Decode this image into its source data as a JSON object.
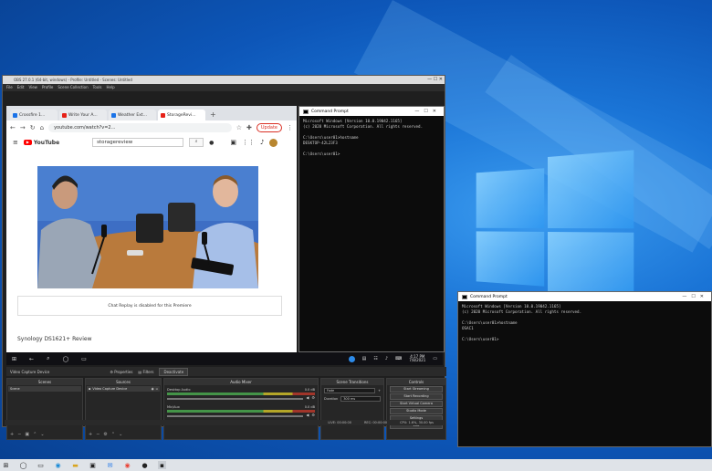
{
  "obs": {
    "title": "OBS 27.0.1 (64-bit, windows) - Profile: Untitled - Scenes: Untitled",
    "menu": [
      "File",
      "Edit",
      "View",
      "Profile",
      "Scene Collection",
      "Tools",
      "Help"
    ]
  },
  "chrome": {
    "tabs": [
      "Crossfire 1...",
      "Write Your A...",
      "Weather Ext...",
      "StorageRevi..."
    ],
    "address": "youtube.com/watch?v=2...",
    "update_label": "Update",
    "search_value": "storagereview",
    "logo_text": "YouTube",
    "chat_text": "Chat Replay is disabled for this Premiere",
    "below_text": "Synology DS1621+ Review"
  },
  "cmd_inner": {
    "title": "Command Prompt",
    "lines": [
      "Microsoft Windows [Version 10.0.19042.1165]",
      "(c) 2020 Microsoft Corporation. All rights reserved.",
      "",
      "C:\\Users\\user01>hostname",
      "DESKTOP-42L23F3",
      "",
      "C:\\Users\\user01>"
    ]
  },
  "inner_taskbar": {
    "time": "4:17 PM",
    "date": "7/8/2021"
  },
  "obs_lower": {
    "context_source": "Video Capture Device",
    "properties_label": "Properties",
    "filters_label": "Filters",
    "device_label": "Deactivate",
    "scenes_header": "Scenes",
    "sources_header": "Sources",
    "mixer_header": "Audio Mixer",
    "transitions_header": "Scene Transitions",
    "controls_header": "Controls",
    "scene_item": "Scene",
    "source_item": "Video Capture Device",
    "mixer_channels": [
      {
        "name": "Desktop Audio",
        "db": "0.0 dB"
      },
      {
        "name": "Mic/Aux",
        "db": "0.0 dB"
      }
    ],
    "transition_value": "Fade",
    "duration_label": "Duration",
    "duration_value": "300 ms",
    "controls": [
      "Start Streaming",
      "Start Recording",
      "Start Virtual Camera",
      "Studio Mode",
      "Settings",
      "Exit"
    ],
    "status": [
      "LIVE: 00:00:00",
      "REC: 00:00:00",
      "CPU: 1.6%, 30.00 fps"
    ]
  },
  "cmd_outer": {
    "title": "Command Prompt",
    "lines": [
      "Microsoft Windows [Version 10.0.19042.1165]",
      "(c) 2020 Microsoft Corporation. All rights reserved.",
      "",
      "C:\\Users\\user01>hostname",
      "OSAC1",
      "",
      "C:\\Users\\user01>"
    ]
  }
}
